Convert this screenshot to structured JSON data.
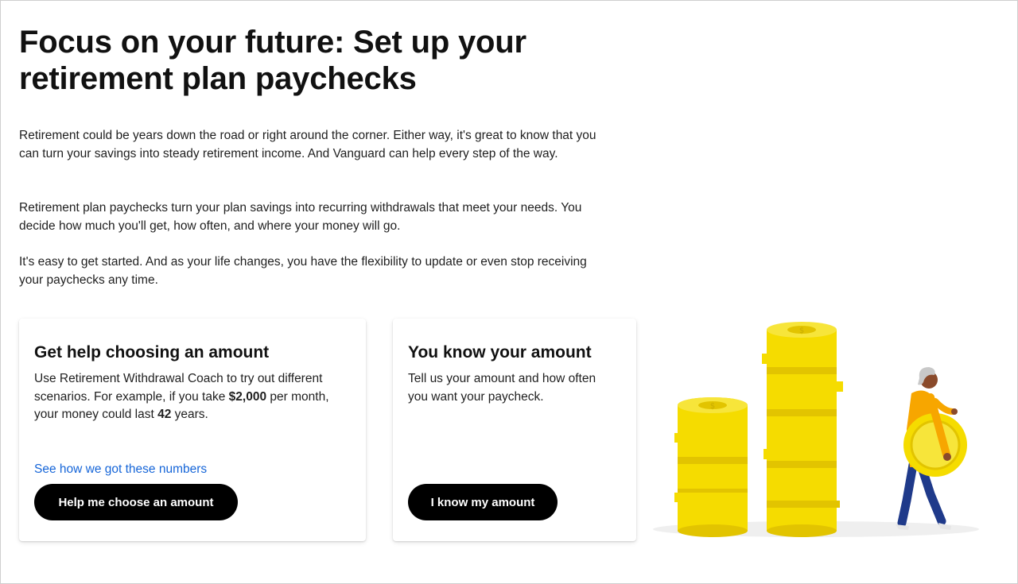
{
  "page": {
    "title": "Focus on your future: Set up your retirement plan paychecks",
    "paragraphs": [
      "Retirement could be years down the road or right around the corner. Either way, it's great to know that you can turn your savings into steady retirement income. And Vanguard can help every step of the way.",
      "Retirement plan paychecks turn your plan savings into recurring withdrawals that meet your needs. You decide how much you'll get, how often, and where your money will go.",
      "It's easy to get started. And as your life changes, you have the flexibility to update or even stop receiving your paychecks any time."
    ]
  },
  "cards": {
    "help": {
      "title": "Get help choosing an amount",
      "body_intro": "Use Retirement Withdrawal Coach to try out different scenarios. For example, if you take ",
      "amount": "$2,000",
      "body_mid": " per month, your money could last ",
      "years": "42",
      "body_end": " years.",
      "link_label": "See how we got these numbers",
      "button_label": "Help me choose an amount"
    },
    "know": {
      "title": "You know your amount",
      "body": "Tell us your amount and how often you want your paycheck.",
      "button_label": "I know my amount"
    }
  },
  "illustration": {
    "icon": "coin-stacks-person-illustration",
    "coin_symbol": "$"
  },
  "colors": {
    "button_bg": "#000000",
    "link": "#1565d8",
    "coin": "#f5dc00",
    "coin_shadow": "#e2c400",
    "shirt": "#f7a600",
    "pants": "#1f3a8a"
  }
}
